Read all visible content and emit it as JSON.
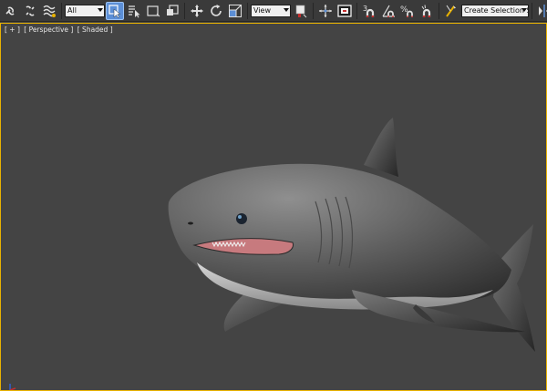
{
  "toolbar": {
    "selection_filter": "All",
    "reference_coordinate": "View",
    "named_selection_placeholder": "Create Selection Se",
    "snap_number": "3",
    "percent_snap": "%",
    "active_color": "#5c8fd6",
    "icons": [
      "link-icon",
      "unlink-icon",
      "bind-space-warp-icon",
      "select-object-icon",
      "select-by-name-icon",
      "rect-selection-icon",
      "window-crossing-icon",
      "move-icon",
      "rotate-icon",
      "scale-icon",
      "pivot-icon",
      "select-manipulate-icon",
      "keyboard-shortcut-icon",
      "snaps-toggle-icon",
      "angle-snap-icon",
      "percent-snap-icon",
      "spinner-snap-icon",
      "edit-named-selection-icon",
      "mirror-icon"
    ]
  },
  "viewport": {
    "label_plus": "[ + ]",
    "label_view": "[ Perspective ]",
    "label_shading": "[ Shaded ]",
    "border_color": "#e8b200",
    "background": "#444444"
  }
}
